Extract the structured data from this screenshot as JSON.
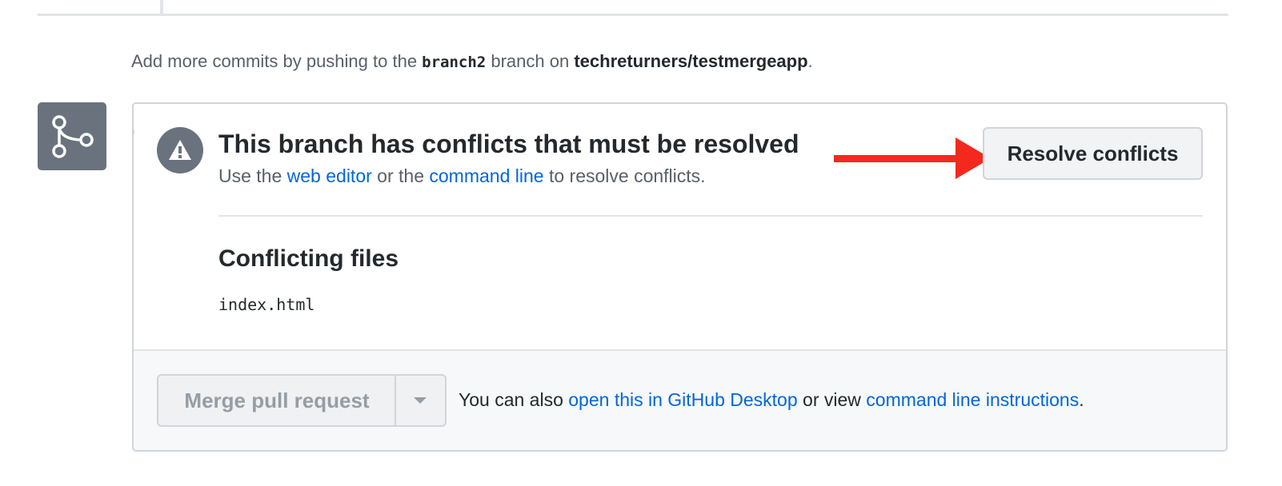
{
  "hint": {
    "prefix": "Add more commits by pushing to the ",
    "branch": "branch2",
    "middle": " branch on ",
    "repo": "techreturners/testmergeapp",
    "suffix": "."
  },
  "conflict": {
    "title": "This branch has conflicts that must be resolved",
    "sub_prefix": "Use the ",
    "web_editor_link": "web editor",
    "sub_middle": " or the ",
    "command_line_link": "command line",
    "sub_suffix": " to resolve conflicts.",
    "resolve_button": "Resolve conflicts"
  },
  "files": {
    "heading": "Conflicting files",
    "items": [
      "index.html"
    ]
  },
  "footer": {
    "merge_button": "Merge pull request",
    "text_prefix": "You can also ",
    "desktop_link": "open this in GitHub Desktop",
    "text_middle": " or view ",
    "instructions_link": "command line instructions",
    "text_suffix": "."
  },
  "icons": {
    "merge": "git-merge-icon",
    "alert": "alert-icon",
    "dropdown": "triangle-down-icon",
    "annotation": "red-arrow-icon"
  },
  "colors": {
    "link": "#0366d6",
    "icon_bg": "#6a737d",
    "annotation_arrow": "#f5281e"
  }
}
